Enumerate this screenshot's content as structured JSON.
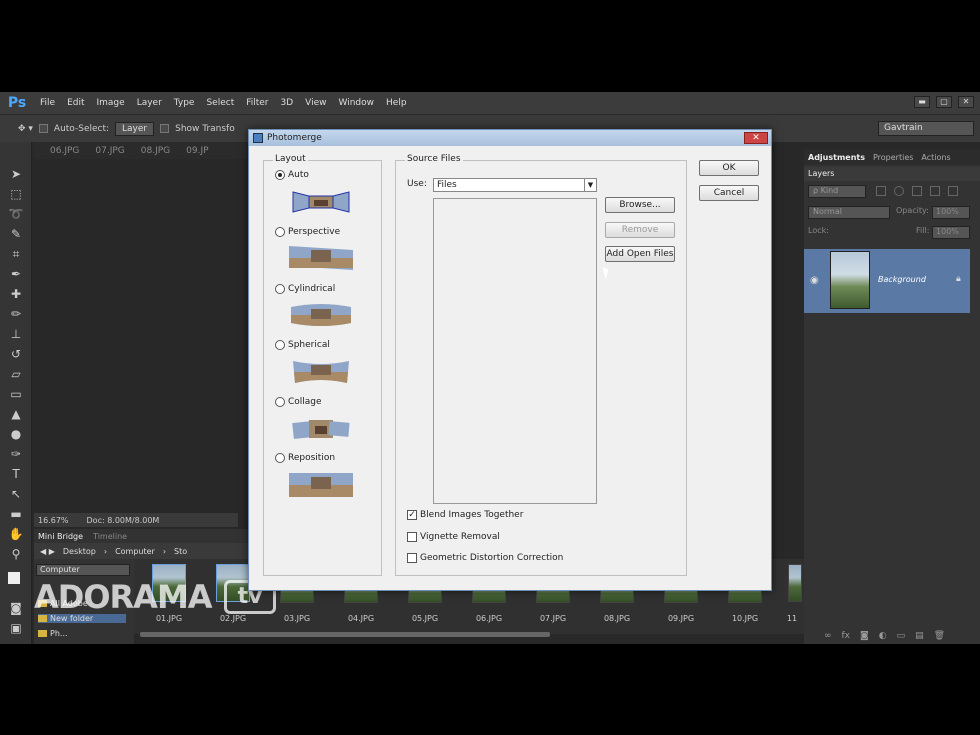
{
  "app": {
    "logo": "Ps"
  },
  "menu": [
    "File",
    "Edit",
    "Image",
    "Layer",
    "Type",
    "Select",
    "Filter",
    "3D",
    "View",
    "Window",
    "Help"
  ],
  "window_controls": [
    "▬",
    "▢",
    "✕"
  ],
  "options_bar": {
    "auto_select_label": "Auto-Select:",
    "auto_select_value": "Layer",
    "show_transform_label": "Show Transfo",
    "workspace": "Gavtrain"
  },
  "doc_tabs": [
    "06.JPG",
    "07.JPG",
    "08.JPG",
    "09.JP"
  ],
  "status": {
    "zoom": "16.67%",
    "doc": "Doc: 8.00M/8.00M"
  },
  "bridge": {
    "tabs": [
      "Mini Bridge",
      "Timeline"
    ],
    "path": [
      "Desktop",
      "Computer",
      "Sto"
    ],
    "location": "Computer",
    "folders": [
      "All Adobe",
      "New folder",
      "Ph..."
    ],
    "thumbnails": [
      "01.JPG",
      "02.JPG",
      "03.JPG",
      "04.JPG",
      "05.JPG",
      "06.JPG",
      "07.JPG",
      "08.JPG",
      "09.JPG",
      "10.JPG",
      "11"
    ]
  },
  "right_panel": {
    "tabs": [
      "Adjustments",
      "Properties",
      "Actions"
    ],
    "layers_tab": "Layers",
    "kind": "ρ Kind",
    "blend_mode": "Normal",
    "opacity_label": "Opacity:",
    "opacity_value": "100%",
    "lock_label": "Lock:",
    "fill_label": "Fill:",
    "fill_value": "100%",
    "layer_name": "Background"
  },
  "watermark": {
    "brand": "ADORAMA",
    "suffix": "tv"
  },
  "dialog": {
    "title": "Photomerge",
    "layout_label": "Layout",
    "layouts": [
      {
        "label": "Auto",
        "selected": true
      },
      {
        "label": "Perspective",
        "selected": false
      },
      {
        "label": "Cylindrical",
        "selected": false
      },
      {
        "label": "Spherical",
        "selected": false
      },
      {
        "label": "Collage",
        "selected": false
      },
      {
        "label": "Reposition",
        "selected": false
      }
    ],
    "source_files_label": "Source Files",
    "use_label": "Use:",
    "use_value": "Files",
    "browse_label": "Browse...",
    "remove_label": "Remove",
    "add_open_files_label": "Add Open Files",
    "ok_label": "OK",
    "cancel_label": "Cancel",
    "options": [
      {
        "label": "Blend Images Together",
        "checked": true
      },
      {
        "label": "Vignette Removal",
        "checked": false
      },
      {
        "label": "Geometric Distortion Correction",
        "checked": false
      }
    ]
  }
}
